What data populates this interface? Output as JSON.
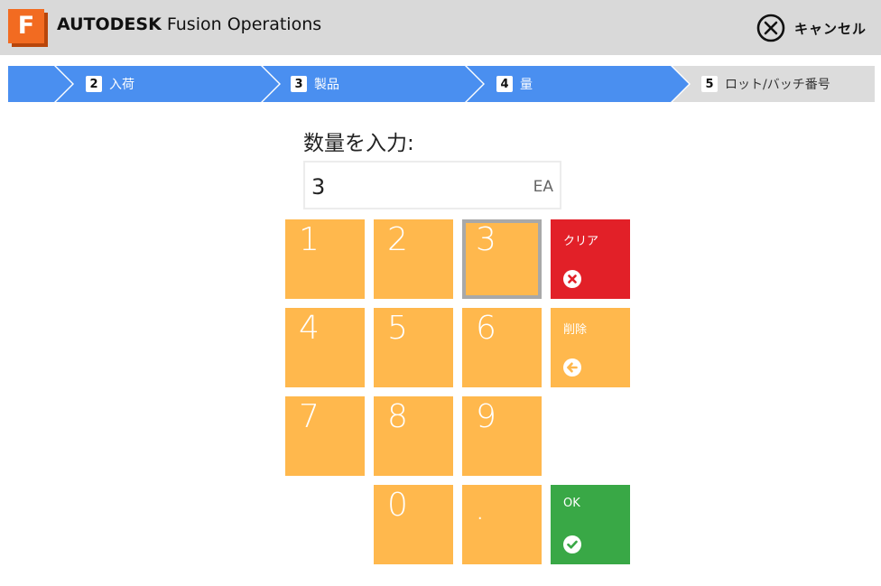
{
  "header": {
    "logo_letter": "F",
    "brand_bold": "AUTODESK",
    "brand_product": "Fusion Operations",
    "cancel_label": "キャンセル"
  },
  "steps": [
    {
      "number": "2",
      "label": "入荷",
      "state": "complete"
    },
    {
      "number": "3",
      "label": "製品",
      "state": "complete"
    },
    {
      "number": "4",
      "label": "量",
      "state": "current"
    },
    {
      "number": "5",
      "label": "ロット/バッチ番号",
      "state": "upcoming"
    }
  ],
  "quantity": {
    "prompt": "数量を入力:",
    "value": "3",
    "unit": "EA"
  },
  "keypad": {
    "k1": "1",
    "k2": "2",
    "k3": "3",
    "k4": "4",
    "k5": "5",
    "k6": "6",
    "k7": "7",
    "k8": "8",
    "k9": "9",
    "k0": "0",
    "kdot": ".",
    "clear_label": "クリア",
    "delete_label": "削除",
    "ok_label": "OK",
    "selected_key": "3"
  },
  "colors": {
    "key": "#ffb84d",
    "clear": "#e22028",
    "ok": "#39a846",
    "step_active": "#4a8ff0",
    "step_inactive": "#dcdcdc",
    "header_bg": "#d9d9d9",
    "logo": "#f26b21"
  }
}
